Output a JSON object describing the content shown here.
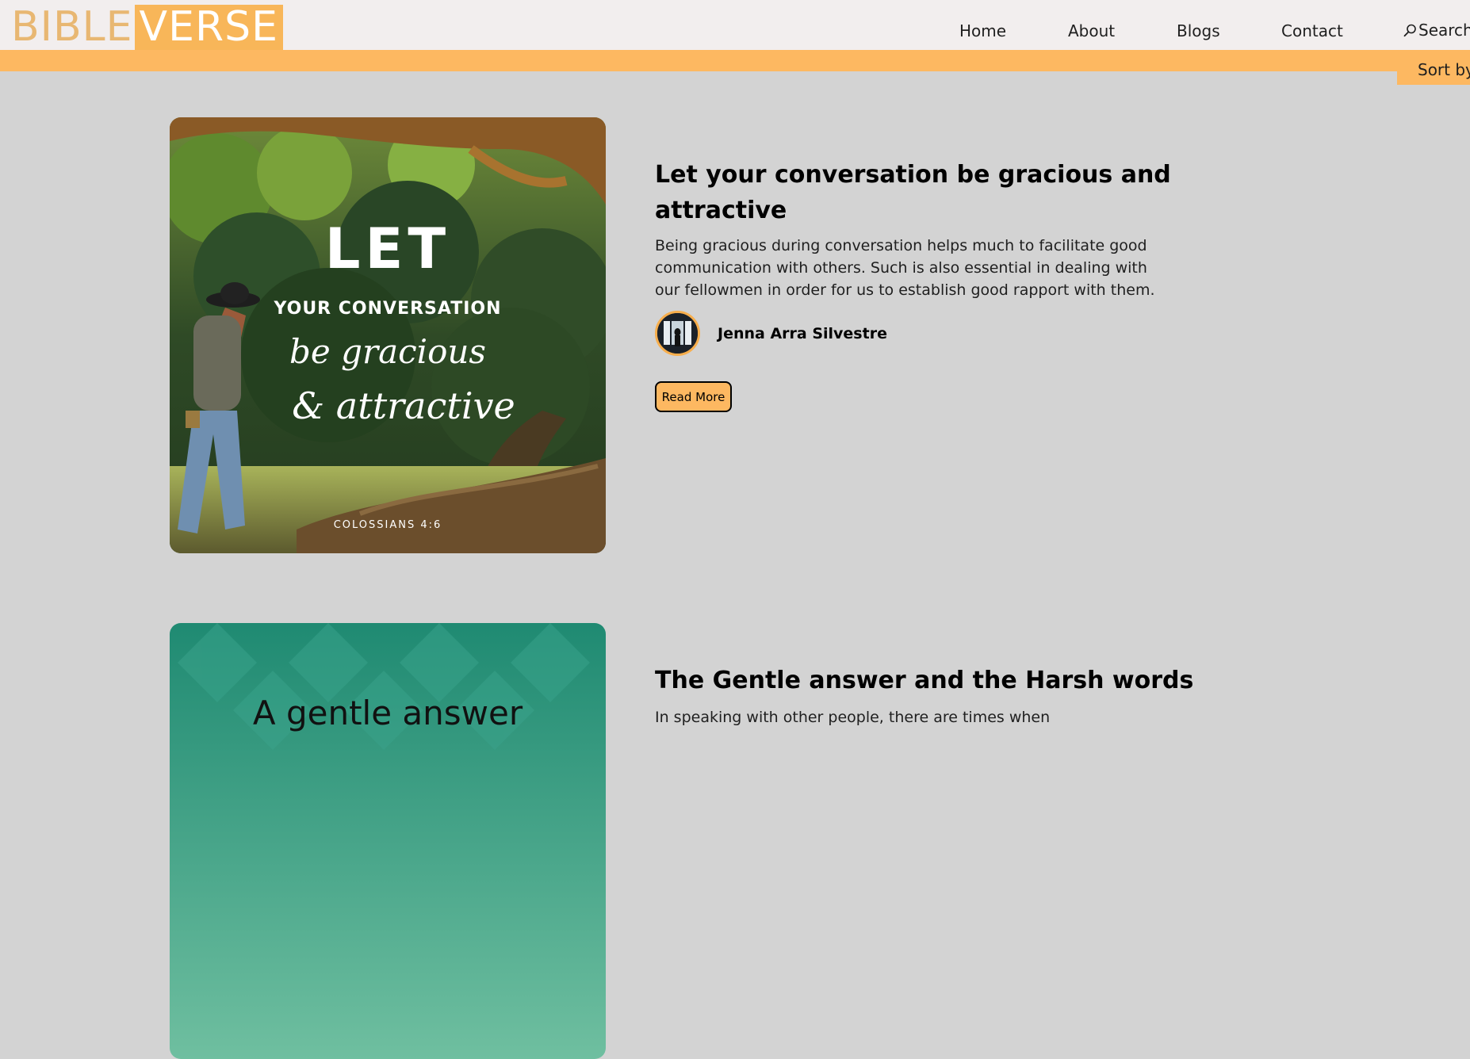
{
  "header": {
    "logo_part1": "BIBLE",
    "logo_part2": "VERSE",
    "nav": [
      {
        "label": "Home"
      },
      {
        "label": "About"
      },
      {
        "label": "Blogs"
      },
      {
        "label": "Contact"
      }
    ],
    "search_label": "Search",
    "search_icon": "search-icon",
    "sort_label": "Sort by"
  },
  "colors": {
    "accent": "#fdb861",
    "logo_text": "#e8b772",
    "page_bg": "#d3d3d3",
    "header_bg": "#f2eeee"
  },
  "posts": [
    {
      "title": "Let your conversation be gracious and attractive",
      "excerpt": "Being gracious during conversation helps much to facilitate good communication with others. Such is also essential in dealing with our fellowmen in order for us to establish good rapport with them.",
      "author": "Jenna Arra Silvestre",
      "read_more": "Read More",
      "image": {
        "line1": "LET",
        "line2": "YOUR CONVERSATION",
        "line3": "be gracious",
        "line4": "& attractive",
        "reference": "COLOSSIANS 4:6"
      }
    },
    {
      "title": "The Gentle answer and the Harsh words",
      "excerpt": "In speaking with other people, there are times when",
      "image": {
        "line1": "A gentle answer"
      }
    }
  ]
}
